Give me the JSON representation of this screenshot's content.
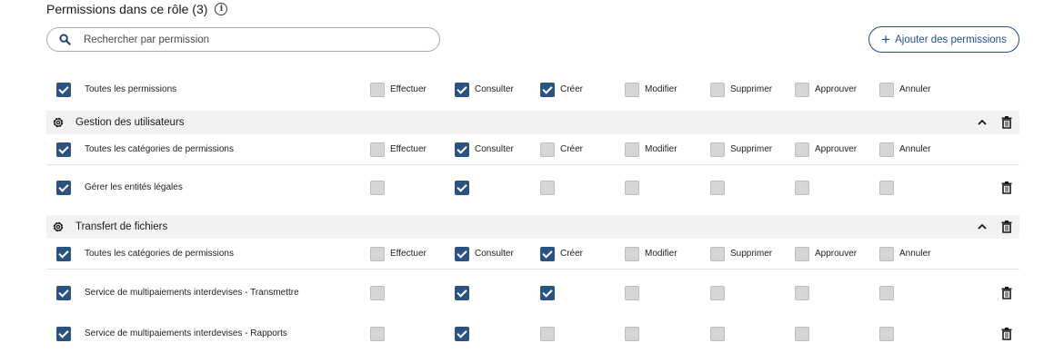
{
  "header": {
    "title": "Permissions dans ce rôle (3)"
  },
  "search": {
    "placeholder": "Rechercher par permission"
  },
  "add_button": {
    "label": "Ajouter des permissions"
  },
  "columns": [
    "Effectuer",
    "Consulter",
    "Créer",
    "Modifier",
    "Supprimer",
    "Approuver",
    "Annuler"
  ],
  "all_row": {
    "label": "Toutes les permissions",
    "checked": true,
    "values": [
      false,
      true,
      true,
      false,
      false,
      false,
      false
    ]
  },
  "sections": [
    {
      "title": "Gestion des utilisateurs",
      "all_label": "Toutes les catégories de permissions",
      "all_checked": true,
      "all_values": [
        false,
        true,
        false,
        false,
        false,
        false,
        false
      ],
      "items": [
        {
          "label": "Gérer les entités légales",
          "checked": true,
          "values": [
            false,
            true,
            false,
            false,
            false,
            false,
            false
          ]
        }
      ]
    },
    {
      "title": "Transfert de fichiers",
      "all_label": "Toutes les catégories de permissions",
      "all_checked": true,
      "all_values": [
        false,
        true,
        true,
        false,
        false,
        false,
        false
      ],
      "items": [
        {
          "label": "Service de multipaiements interdevises - Transmettre",
          "checked": true,
          "values": [
            false,
            true,
            true,
            false,
            false,
            false,
            false
          ]
        },
        {
          "label": "Service de multipaiements interdevises - Rapports",
          "checked": true,
          "values": [
            false,
            true,
            false,
            false,
            false,
            false,
            false
          ]
        }
      ]
    }
  ],
  "icons": {
    "search": "search-icon",
    "info": "info-icon",
    "gear": "gear-icon",
    "chevron": "chevron-up-icon",
    "trash": "trash-icon",
    "plus": "plus-icon"
  },
  "colors": {
    "accent": "#2c5282",
    "button_text": "#1f4f8c",
    "section_bg": "#f2f2f2",
    "unchecked": "#d6d6d6"
  }
}
